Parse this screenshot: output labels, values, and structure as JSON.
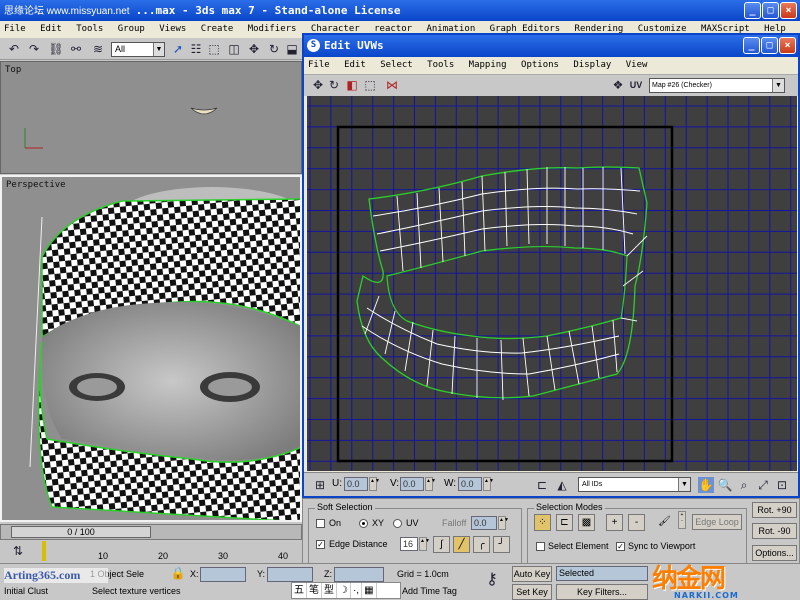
{
  "main_window": {
    "title": "...max - 3ds max 7  - Stand-alone License",
    "watermark": "思缘论坛 www.missyuan.net",
    "menu": [
      "File",
      "Edit",
      "Tools",
      "Group",
      "Views",
      "Create",
      "Modifiers",
      "Character",
      "reactor",
      "Animation",
      "Graph Editors",
      "Rendering",
      "Customize",
      "MAXScript",
      "Help"
    ],
    "selection_filter": "All",
    "win_controls": [
      "_",
      "□",
      "×"
    ]
  },
  "viewports": {
    "top_label": "Top",
    "persp_label": "Perspective"
  },
  "time": {
    "slider": "0 / 100",
    "ticks": [
      "10",
      "20",
      "30",
      "40"
    ],
    "position_fraction": 0
  },
  "status": {
    "initial": "Initial Clust",
    "select_sel": "1 Object Sele",
    "prompt": "Select texture vertices",
    "x_label": "X:",
    "y_label": "Y:",
    "z_label": "Z:",
    "grid": "Grid = 1.0cm",
    "add_time_tag": "Add Time Tag",
    "auto_key": "Auto Key",
    "set_key": "Set Key",
    "selected": "Selected",
    "key_filters": "Key Filters...",
    "ime": [
      "五",
      "笔",
      "型",
      "☽",
      "·,",
      "▦"
    ]
  },
  "watermarks": {
    "arting": "Arting365.com",
    "logo": "纳金网",
    "logo_sub": "NARKII.COM"
  },
  "uvw_dialog": {
    "title": "Edit UVWs",
    "menu": [
      "File",
      "Edit",
      "Select",
      "Tools",
      "Mapping",
      "Options",
      "Display",
      "View"
    ],
    "uv_label": "UV",
    "map_dropdown": "Map #26 (Checker)",
    "u_label": "U:",
    "v_label": "V:",
    "w_label": "W:",
    "u_value": "0.0",
    "v_value": "0.0",
    "w_value": "0.0",
    "ids_dropdown": "All IDs",
    "colors": {
      "grid": "#1414a0",
      "mesh": "#ffffff",
      "border": "#2bd02b",
      "bg": "#3f3f3f"
    }
  },
  "soft_selection": {
    "title": "Soft Selection",
    "on": "On",
    "xy": "XY",
    "uv": "UV",
    "falloff": "Falloff",
    "falloff_value": "0.0",
    "edge_distance": "Edge Distance",
    "edge_distance_value": "16",
    "edge_distance_checked": true,
    "on_checked": false
  },
  "selection_modes": {
    "title": "Selection Modes",
    "plus": "+",
    "minus": "-",
    "edge_loop": "Edge Loop",
    "select_element": "Select Element",
    "sync": "Sync to Viewport",
    "select_element_checked": false,
    "sync_checked": true
  },
  "rotate": {
    "plus90": "Rot. +90",
    "minus90": "Rot. -90",
    "options": "Options..."
  }
}
